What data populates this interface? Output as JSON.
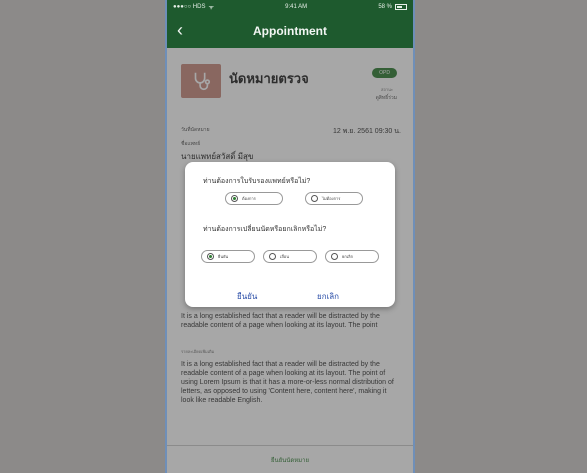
{
  "status_bar": {
    "carrier": "●●●○○ HDS",
    "wifi": "ᯤ",
    "time": "9:41 AM",
    "battery_pct": "58 %"
  },
  "nav": {
    "back_glyph": "‹",
    "title": "Appointment"
  },
  "card": {
    "title": "นัดหมายตรวจ",
    "badge": "OPD",
    "sub1": "สถานะ",
    "sub2": "ดูสิทธิ์ร่วม"
  },
  "details": {
    "date_label": "วันที่นัดหมาย",
    "date_value": "12 พ.ย. 2561 09:30 น.",
    "doctor_label": "ชื่อแพทย์",
    "doctor_value": "นายแพทย์สวัสดิ์ มีสุข"
  },
  "body_text": {
    "para1": "It is a long established fact that a reader will be distracted by the readable content of a page when looking at its layout. The point",
    "label2": "รายละเอียดเพิ่มเติม",
    "para2": "It is a long established fact that a reader will be distracted by the readable content of a page when looking at its layout. The point of using Lorem Ipsum is that it has a more-or-less normal distribution of letters, as opposed to using 'Content here, content here', making it look like readable English."
  },
  "footer": {
    "button_label": "ยืนยันนัดหมาย"
  },
  "dialog": {
    "question1": "ท่านต้องการใบรับรองแพทย์หรือไม่?",
    "q1_options": [
      {
        "label": "ต้องการ",
        "selected": true
      },
      {
        "label": "ไม่ต้องการ",
        "selected": false
      }
    ],
    "question2": "ท่านต้องการเปลี่ยนนัดหรือยกเลิกหรือไม่?",
    "q2_options": [
      {
        "label": "ยืนยัน",
        "selected": true
      },
      {
        "label": "เลื่อน",
        "selected": false
      },
      {
        "label": "ยกเลิก",
        "selected": false
      }
    ],
    "confirm_label": "ยืนยัน",
    "cancel_label": "ยกเลิก"
  },
  "colors": {
    "brand_green": "#1e5a2e",
    "accent_green": "#2e7d32",
    "dialog_link": "#2b4ea8"
  }
}
